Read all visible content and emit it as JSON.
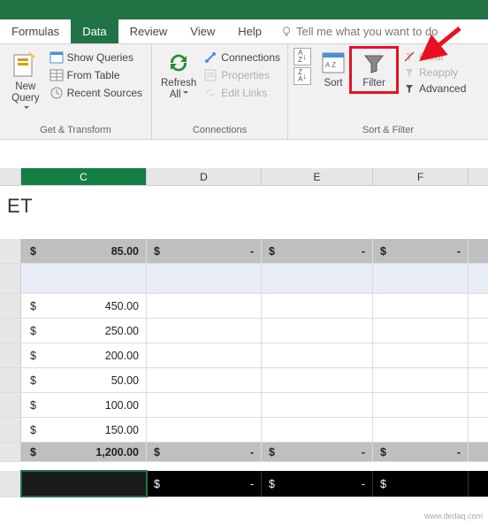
{
  "tabs": {
    "formulas": "Formulas",
    "data": "Data",
    "review": "Review",
    "view": "View",
    "help": "Help",
    "tellme": "Tell me what you want to do"
  },
  "ribbon": {
    "new_query": "New\nQuery",
    "show_queries": "Show Queries",
    "from_table": "From Table",
    "recent_sources": "Recent Sources",
    "group_get": "Get & Transform",
    "refresh_all": "Refresh\nAll",
    "connections": "Connections",
    "properties": "Properties",
    "edit_links": "Edit Links",
    "group_conn": "Connections",
    "sort_az": "A↓Z",
    "sort_za": "Z↓A",
    "sort": "Sort",
    "filter": "Filter",
    "clear": "Clear",
    "reapply": "Reapply",
    "advanced": "Advanced",
    "group_sort": "Sort & Filter"
  },
  "columns": {
    "c": "C",
    "d": "D",
    "e": "E",
    "f": "F"
  },
  "title_cell": "ET",
  "currency": "$",
  "dash": "-",
  "summary_value": "85.00",
  "rows": [
    "450.00",
    "250.00",
    "200.00",
    "50.00",
    "100.00",
    "150.00"
  ],
  "total_value": "1,200.00",
  "watermark": "www.dedaq.com"
}
